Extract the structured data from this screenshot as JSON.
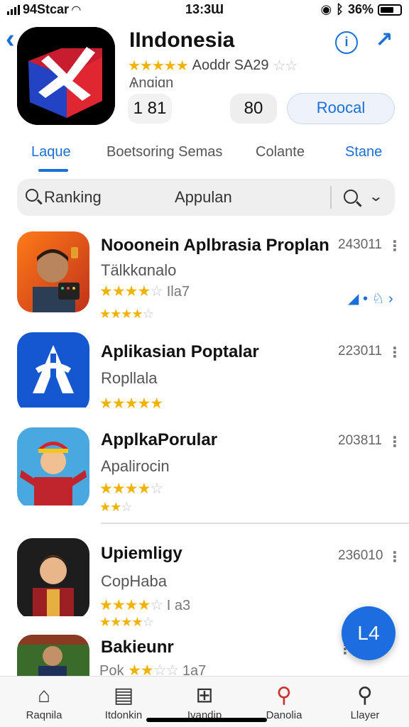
{
  "status": {
    "carrier": "94Stcar",
    "time": "13:3Ɯ",
    "battery": "36%"
  },
  "app": {
    "title": "IIndonesia",
    "subtitle": "Aoddr SA29",
    "category": "Ѧnɑiɑn",
    "rank": "1 81",
    "age": "80",
    "get_label": "Roocal"
  },
  "tabs": [
    {
      "label": "Laque",
      "active": true
    },
    {
      "label": "Boetsoring Semas",
      "active": false
    },
    {
      "label": "Colante",
      "active": false
    },
    {
      "label": "Stane",
      "active": false
    }
  ],
  "search": {
    "label": "Ranking",
    "center": "Appulan"
  },
  "list": [
    {
      "title": "Nooonein Aplbrasia Proplan",
      "subtitle": "Tälkkɑnalo",
      "rating_text": "Ila7",
      "stars": 4,
      "date": "243011"
    },
    {
      "title": "Aplikasian Poptalar",
      "subtitle": "Ropllala",
      "rating_text": "",
      "stars": 4.5,
      "date": "223011"
    },
    {
      "title": "ApplkaPorular",
      "subtitle": "Apalirocin",
      "rating_text": "",
      "stars": 4,
      "date": "203811"
    },
    {
      "title": "Upiemligy",
      "subtitle": "CopHaba",
      "rating_text": "I a3",
      "stars": 4,
      "date": "236010"
    },
    {
      "title": "Bakieunr",
      "subtitle": "Pok",
      "rating_text": "1a7",
      "stars": 2,
      "date": ""
    }
  ],
  "fab": {
    "label": "L4"
  },
  "tabbar": [
    {
      "label": "Raqnila",
      "icon": "home-icon"
    },
    {
      "label": "Itdonkin",
      "icon": "book-icon"
    },
    {
      "label": "Ivandip",
      "icon": "plus-icon"
    },
    {
      "label": "Danolia",
      "icon": "search-red-icon"
    },
    {
      "label": "Llayer",
      "icon": "search-icon"
    }
  ],
  "colors": {
    "accent": "#1a6fd8",
    "star": "#f2b200",
    "fab": "#1b6de0"
  }
}
